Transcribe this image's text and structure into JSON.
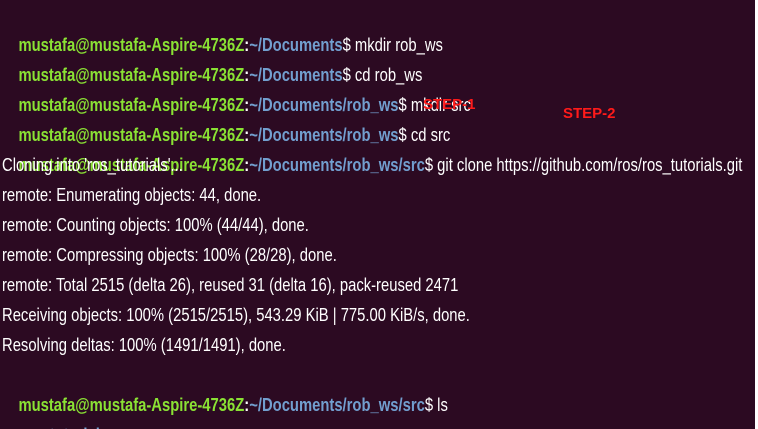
{
  "colors": {
    "background": "#2c0a22",
    "user_host": "#8ae234",
    "path": "#729fcf",
    "text": "#ffffff",
    "annotation": "#ff1a1a"
  },
  "prompt_user": "mustafa@mustafa-Aspire-4736Z",
  "lines": [
    {
      "type": "prompt",
      "path": "~/Documents",
      "command": " mkdir rob_ws"
    },
    {
      "type": "prompt",
      "path": "~/Documents",
      "command": " cd rob_ws"
    },
    {
      "type": "prompt",
      "path": "~/Documents/rob_ws",
      "command": " mkdir src"
    },
    {
      "type": "prompt",
      "path": "~/Documents/rob_ws",
      "command": " cd src"
    },
    {
      "type": "prompt",
      "path": "~/Documents/rob_ws/src",
      "command": " git clone https://github.com/ros/ros_tutorials.git"
    },
    {
      "type": "output",
      "text": "Cloning into 'ros_tutorials'..."
    },
    {
      "type": "output",
      "text": "remote: Enumerating objects: 44, done."
    },
    {
      "type": "output",
      "text": "remote: Counting objects: 100% (44/44), done."
    },
    {
      "type": "output",
      "text": "remote: Compressing objects: 100% (28/28), done."
    },
    {
      "type": "output",
      "text": "remote: Total 2515 (delta 26), reused 31 (delta 16), pack-reused 2471"
    },
    {
      "type": "output",
      "text": "Receiving objects: 100% (2515/2515), 543.29 KiB | 775.00 KiB/s, done."
    },
    {
      "type": "output",
      "text": "Resolving deltas: 100% (1491/1491), done."
    },
    {
      "type": "prompt",
      "path": "~/Documents/rob_ws/src",
      "command": " ls"
    },
    {
      "type": "dir",
      "text": "ros_tutorials"
    }
  ],
  "annotations": {
    "step1": "STEP-1",
    "step2": "STEP-2"
  }
}
